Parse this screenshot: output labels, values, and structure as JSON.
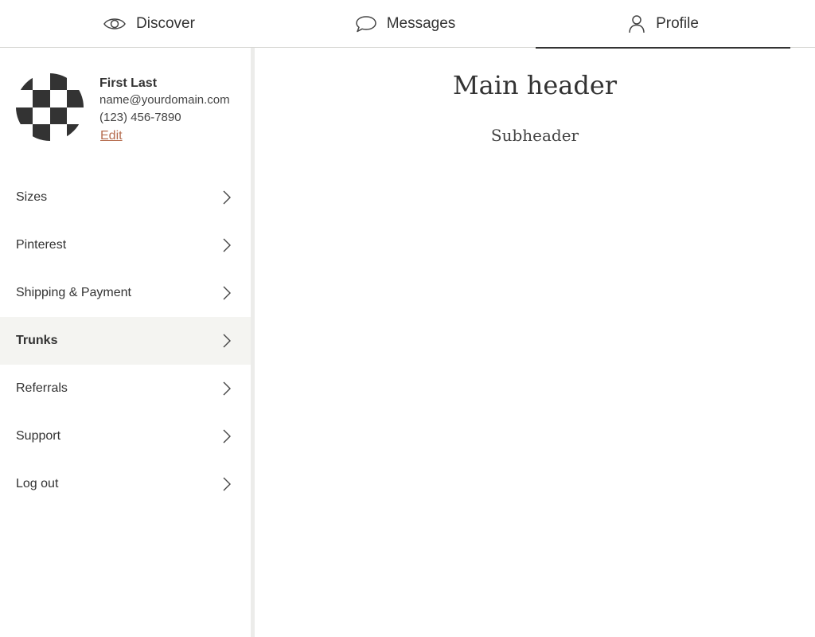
{
  "tabs": [
    {
      "label": "Discover",
      "icon": "eye-icon"
    },
    {
      "label": "Messages",
      "icon": "speech-bubble-icon"
    },
    {
      "label": "Profile",
      "icon": "person-icon",
      "active": true
    }
  ],
  "profile": {
    "name": "First Last",
    "email": "name@yourdomain.com",
    "phone": "(123) 456-7890",
    "edit_label": "Edit"
  },
  "menu": {
    "items": [
      {
        "label": "Sizes"
      },
      {
        "label": "Pinterest"
      },
      {
        "label": "Shipping & Payment"
      },
      {
        "label": "Trunks",
        "active": true
      },
      {
        "label": "Referrals"
      },
      {
        "label": "Support"
      },
      {
        "label": "Log out"
      }
    ],
    "chevron_icon": "chevron-right-icon"
  },
  "main": {
    "header": "Main header",
    "subheader": "Subheader"
  },
  "colors": {
    "text": "#333333",
    "accent_link": "#b56c4e",
    "active_row_bg": "#f4f4f1",
    "divider": "#ececea"
  }
}
